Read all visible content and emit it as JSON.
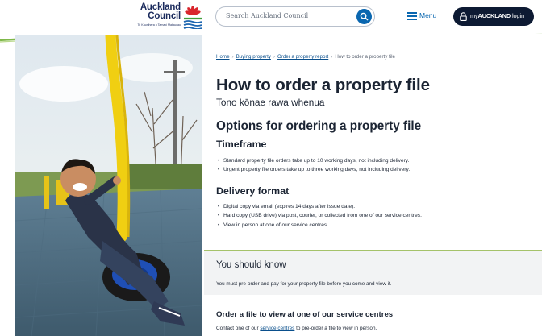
{
  "header": {
    "logo_line1": "Auckland",
    "logo_line2": "Council",
    "logo_sub": "Te Kaunihera o Tamaki Makaurau",
    "search_placeholder": "Search Auckland Council",
    "menu_label": "Menu",
    "login_prefix": "my",
    "login_brand": "AUCKLAND",
    "login_suffix": " login"
  },
  "breadcrumb": {
    "items": [
      "Home",
      "Buying property",
      "Order a property report"
    ],
    "current": "How to order a property file",
    "separator": "›"
  },
  "page": {
    "title": "How to order a property file",
    "subtitle": "Tono kōnae rawa whenua"
  },
  "options": {
    "heading": "Options for ordering a property file",
    "timeframe_heading": "Timeframe",
    "timeframe_items": [
      "Standard property file orders take up to 10 working days, not including delivery.",
      "Urgent property file orders take up to three working days, not including delivery."
    ],
    "delivery_heading": "Delivery format",
    "delivery_items": [
      "Digital copy via email (expires 14 days after issue date).",
      "Hard copy (USB drive) via post, courier, or collected from one of our service centres.",
      "View in person at one of our service centres."
    ]
  },
  "know": {
    "title": "You should know",
    "text": "You must pre-order and pay for your property file before you come and view it."
  },
  "service": {
    "heading": "Order a file to view at one of our service centres",
    "text_before": "Contact one of our ",
    "link": "service centres",
    "text_after": " to pre-order a file to view in person."
  },
  "colors": {
    "accent_blue": "#0a67b0",
    "navy": "#0d1a33",
    "divider_green": "#a5c26a",
    "panel_grey": "#f2f3f4"
  },
  "icons": [
    "search-icon",
    "hamburger-menu-icon",
    "lock-icon",
    "council-logo-icon"
  ]
}
